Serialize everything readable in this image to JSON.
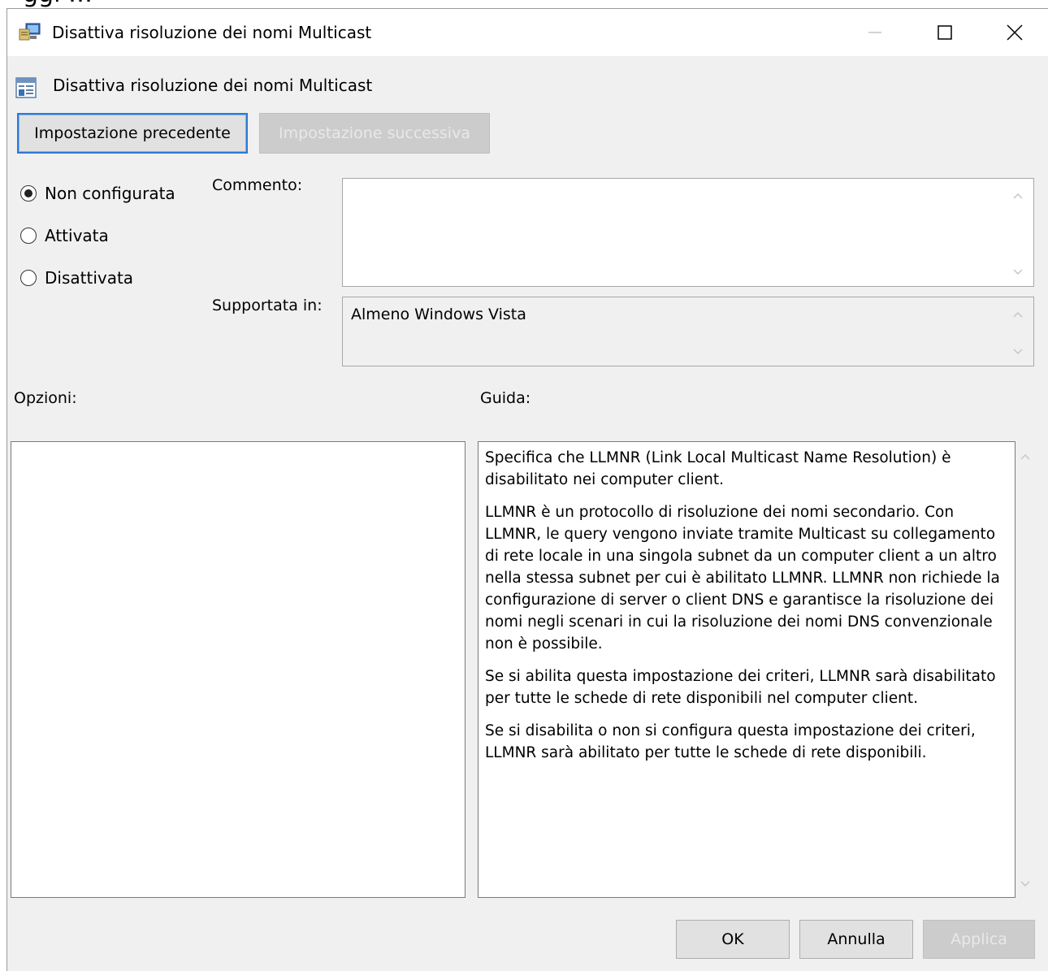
{
  "top_fragment": "ggi     …",
  "window": {
    "title": "Disattiva risoluzione dei nomi Multicast",
    "icons": {
      "app": "computer-policy-icon",
      "minimize": "minimize-icon",
      "maximize": "maximize-icon",
      "close": "close-icon"
    }
  },
  "policy": {
    "title": "Disattiva risoluzione dei nomi Multicast",
    "icon": "policy-setting-icon"
  },
  "nav": {
    "previous_label": "Impostazione precedente",
    "next_label": "Impostazione successiva"
  },
  "state_options": [
    {
      "label": "Non configurata",
      "selected": true
    },
    {
      "label": "Attivata",
      "selected": false
    },
    {
      "label": "Disattivata",
      "selected": false
    }
  ],
  "comment": {
    "label": "Commento:",
    "value": ""
  },
  "supported": {
    "label": "Supportata in:",
    "value": "Almeno Windows Vista"
  },
  "options_label": "Opzioni:",
  "help_label": "Guida:",
  "help_paragraphs": [
    "Specifica che LLMNR (Link Local Multicast Name Resolution) è disabilitato nei computer client.",
    "LLMNR è un protocollo di risoluzione dei nomi secondario. Con LLMNR, le query vengono inviate tramite Multicast su collegamento di rete locale in una singola subnet da un computer client a un altro nella stessa subnet per cui è abilitato LLMNR. LLMNR non richiede la configurazione di server o client DNS e garantisce la risoluzione dei nomi negli scenari in cui la risoluzione dei nomi DNS convenzionale non è possibile.",
    "Se si abilita questa impostazione dei criteri, LLMNR sarà disabilitato per tutte le schede di rete disponibili nel computer client.",
    "Se si disabilita o non si configura questa impostazione dei criteri, LLMNR sarà abilitato per tutte le schede di rete disponibili."
  ],
  "footer": {
    "ok_label": "OK",
    "cancel_label": "Annulla",
    "apply_label": "Applica"
  }
}
